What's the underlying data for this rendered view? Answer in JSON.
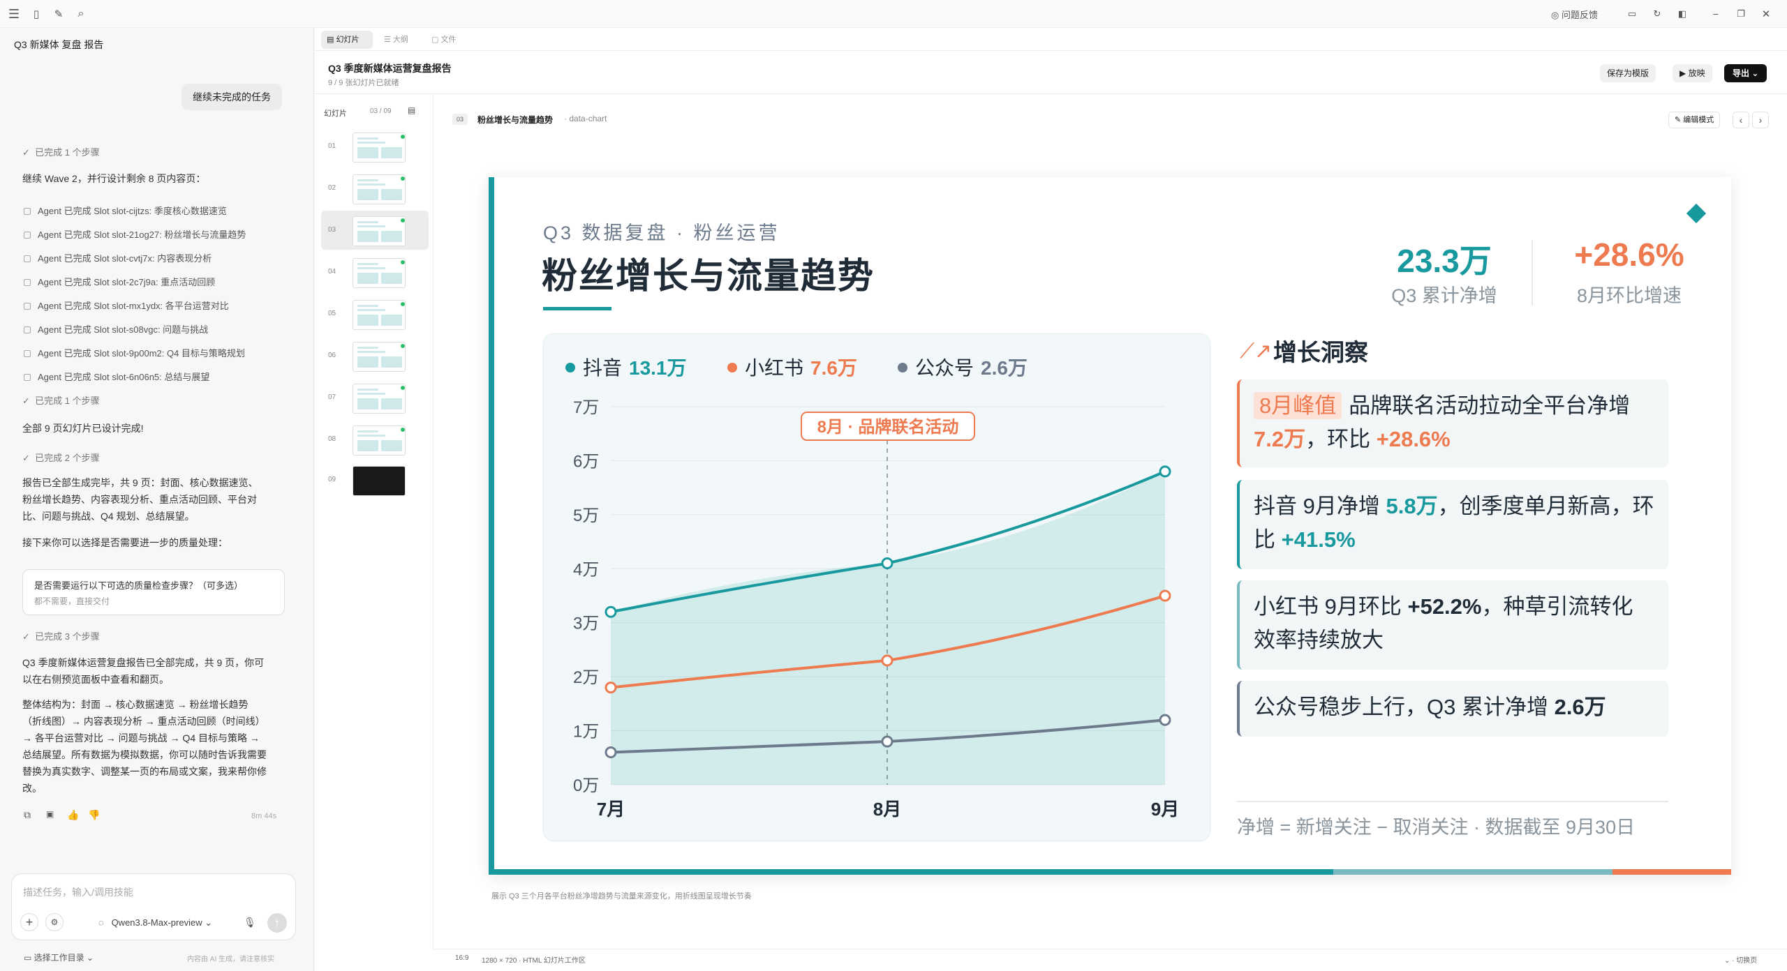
{
  "app": {
    "feedback": "问题反馈"
  },
  "chat": {
    "title": "Q3 新媒体 复盘 报告",
    "user_msg": "继续未完成的任务",
    "step1": "已完成 1 个步骤",
    "wave": "继续 Wave 2，并行设计剩余 8 页内容页：",
    "agents": [
      "Agent 已完成 Slot slot-cijtzs: 季度核心数据速览",
      "Agent 已完成 Slot slot-21og27: 粉丝增长与流量趋势",
      "Agent 已完成 Slot slot-cvtj7x: 内容表现分析",
      "Agent 已完成 Slot slot-2c7j9a: 重点活动回顾",
      "Agent 已完成 Slot slot-mx1ydx: 各平台运营对比",
      "Agent 已完成 Slot slot-s08vgc: 问题与挑战",
      "Agent 已完成 Slot slot-9p00m2: Q4 目标与策略规划",
      "Agent 已完成 Slot slot-6n06n5: 总结与展望"
    ],
    "step2": "已完成 1 个步骤",
    "done_all": "全部 9 页幻灯片已设计完成!",
    "step3": "已完成 2 个步骤",
    "summary1a": "报告已全部生成完毕，共 9 页：封面、核心数据速览、",
    "summary1b": "粉丝增长趋势、内容表现分析、重点活动回顾、平台对",
    "summary1c": "比、问题与挑战、Q4 规划、总结展望。",
    "next": "接下来你可以选择是否需要进一步的质量处理：",
    "question": "是否需要运行以下可选的质量检查步骤？（可多选）",
    "answer": "都不需要，直接交付",
    "step4": "已完成 3 个步骤",
    "final1a": "Q3 季度新媒体运营复盘报告已全部完成，共 9 页，你可",
    "final1b": "以在右侧预览面板中查看和翻页。",
    "final2a": "整体结构为：封面 → 核心数据速览 → 粉丝增长趋势",
    "final2b": "（折线图）→ 内容表现分析 → 重点活动回顾（时间线）",
    "final2c": "→ 各平台运营对比 → 问题与挑战 → Q4 目标与策略 →",
    "final2d": "总结展望。所有数据为模拟数据，你可以随时告诉我需要",
    "final2e": "替换为真实数字、调整某一页的布局或文案，我来帮你修",
    "final2f": "改。",
    "elapsed": "8m 44s",
    "input_placeholder": "描述任务，输入/调用技能",
    "model": "Qwen3.8-Max-preview",
    "workdir": "选择工作目录",
    "disclaimer": "内容由 AI 生成，请注意核实"
  },
  "tabs": [
    "幻灯片",
    "大纲",
    "文件"
  ],
  "doc": {
    "title": "Q3 季度新媒体运营复盘报告",
    "status": "9 / 9 张幻灯片已就绪",
    "save_template": "保存为模版",
    "play": "放映",
    "export": "导出"
  },
  "panel": {
    "label": "幻灯片",
    "pager": "03 / 09",
    "nums": [
      "01",
      "02",
      "03",
      "04",
      "05",
      "06",
      "07",
      "08",
      "09"
    ]
  },
  "crumb": {
    "num": "03",
    "title": "粉丝增长与流量趋势",
    "type": "data-chart",
    "edit": "编辑模式"
  },
  "slide": {
    "eyebrow": "Q3 数据复盘 · 粉丝运营",
    "title": "粉丝增长与流量趋势",
    "kpi1": {
      "value": "23.3万",
      "label": "Q3 累计净增"
    },
    "kpi2": {
      "value": "+28.6%",
      "label": "8月环比增速"
    },
    "annotation": "8月 · 品牌联名活动",
    "insight_title": "增长洞察",
    "footnote": "净增 = 新增关注 − 取消关注 · 数据截至 9月30日",
    "cards": [
      {
        "tag": "8月峰值",
        "a": "品牌联名活动拉动全平台净增",
        "b": "7.2万",
        "c": "，环比 ",
        "d": "+28.6%"
      },
      {
        "a": "抖音 9月净增 ",
        "b": "5.8万",
        "c": "，创季度单月新高，环比 ",
        "d": "+41.5%"
      },
      {
        "a": "小红书 9月环比 ",
        "b": "+52.2%",
        "c": "，种草引流转化效率持续放大"
      },
      {
        "a": "公众号稳步上行，Q3 累计净增 ",
        "b": "2.6万"
      }
    ]
  },
  "caption": "展示 Q3 三个月各平台粉丝净增趋势与流量来源变化，用折线图呈现增长节奏",
  "statusbar": {
    "ratio": "16:9",
    "size": "1280 × 720 · HTML 幻灯片工作区",
    "toggle": "切换页"
  },
  "colors": {
    "teal": "#17999e",
    "orange": "#ee7a4f",
    "slate": "#6c7a8c",
    "dark": "#1f2b36"
  },
  "chart_data": {
    "type": "line",
    "categories": [
      "7月",
      "8月",
      "9月"
    ],
    "ylim": [
      0,
      7
    ],
    "yticks": [
      "0万",
      "1万",
      "2万",
      "3万",
      "4万",
      "5万",
      "6万",
      "7万"
    ],
    "series": [
      {
        "name": "抖音",
        "total": "13.1万",
        "values": [
          3.2,
          4.1,
          5.8
        ],
        "color": "#17999e"
      },
      {
        "name": "小红书",
        "total": "7.6万",
        "values": [
          1.8,
          2.3,
          3.5
        ],
        "color": "#ee7a4f"
      },
      {
        "name": "公众号",
        "total": "2.6万",
        "values": [
          0.6,
          0.8,
          1.2
        ],
        "color": "#6c7a8c"
      }
    ]
  }
}
